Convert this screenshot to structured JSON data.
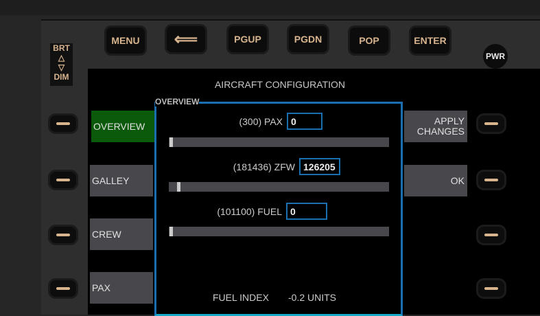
{
  "top_keys": [
    {
      "label": "MENU"
    },
    {
      "label": "⟸"
    },
    {
      "label": "PGUP"
    },
    {
      "label": "PGDN"
    },
    {
      "label": "POP"
    },
    {
      "label": "ENTER"
    }
  ],
  "pwr": "PWR",
  "brt": "BRT",
  "dim": "DIM",
  "screen_title": "AIRCRAFT CONFIGURATION",
  "panel_title": "OVERVIEW",
  "left_menu": [
    {
      "label": "OVERVIEW",
      "active": true
    },
    {
      "label": "GALLEY"
    },
    {
      "label": "CREW"
    },
    {
      "label": "PAX"
    }
  ],
  "right_menu": [
    {
      "label": "APPLY CHANGES"
    },
    {
      "label": "OK"
    }
  ],
  "fields": [
    {
      "label": "(300) PAX",
      "value": "0",
      "slider_fraction": 0.0
    },
    {
      "label": "(181436) ZFW",
      "value": "126205",
      "slider_fraction": 0.035
    },
    {
      "label": "(101100) FUEL",
      "value": "0",
      "slider_fraction": 0.0
    }
  ],
  "fuel_index": {
    "label": "FUEL INDEX",
    "value": "-0.2 UNITS"
  },
  "colors": {
    "accent": "#1a6fb0",
    "active": "#0b5a0b",
    "key_text": "#d8b48e"
  }
}
